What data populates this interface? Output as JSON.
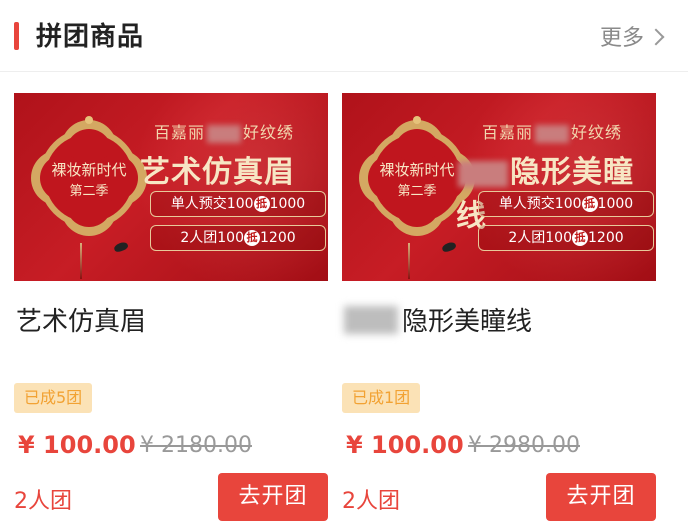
{
  "header": {
    "title": "拼团商品",
    "more_label": "更多"
  },
  "colors": {
    "accent": "#e8453c",
    "badge_bg": "#fbe2b6",
    "badge_text": "#f2a233",
    "banner_red": "#b0121a"
  },
  "products": [
    {
      "banner": {
        "badge_line1": "裸妆新时代",
        "badge_line2": "第二季",
        "brand_left": "百嘉丽",
        "brand_right": "好纹绣",
        "headline": "艺术仿真眉",
        "promo1_left": "单人预交100",
        "promo1_mark": "抵",
        "promo1_right": "1000",
        "promo2_left": "2人团100",
        "promo2_mark": "抵",
        "promo2_right": "1200"
      },
      "name_visible": "艺术仿真眉",
      "grouped_count": "已成5团",
      "price": "¥ 100.00",
      "original_price": "¥ 2180.00",
      "team_size": "2人团",
      "button_label": "去开团"
    },
    {
      "banner": {
        "badge_line1": "裸妆新时代",
        "badge_line2": "第二季",
        "brand_left": "百嘉丽",
        "brand_right": "好纹绣",
        "headline": "隐形美瞳线",
        "promo1_left": "单人预交100",
        "promo1_mark": "抵",
        "promo1_right": "1000",
        "promo2_left": "2人团100",
        "promo2_mark": "抵",
        "promo2_right": "1200"
      },
      "name_visible": "隐形美瞳线",
      "grouped_count": "已成1团",
      "price": "¥ 100.00",
      "original_price": "¥ 2980.00",
      "team_size": "2人团",
      "button_label": "去开团"
    }
  ]
}
